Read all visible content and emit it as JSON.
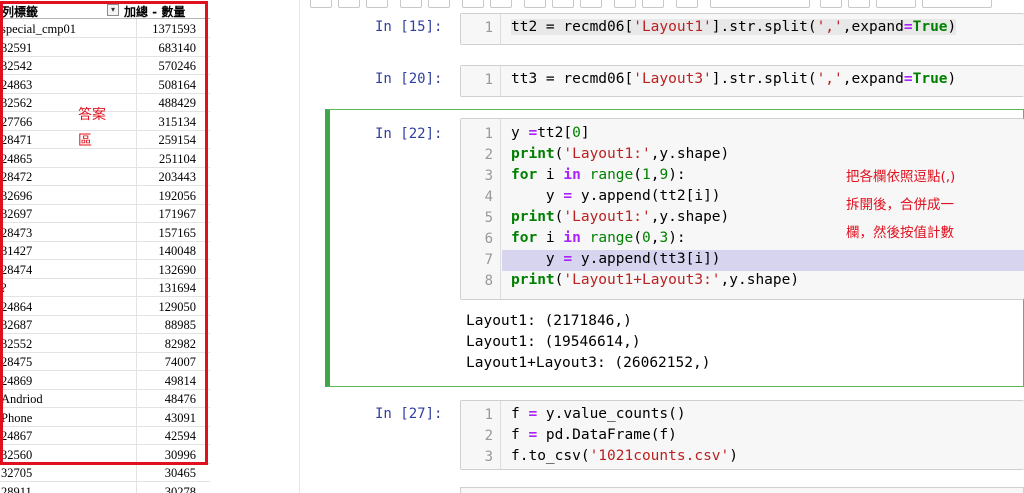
{
  "pivot": {
    "header_label": "列標籤",
    "header_value": "加總 - 數量",
    "filter_icon": "filter-dropdown-icon",
    "rows": [
      {
        "label": "special_cmp01",
        "value": "1371593"
      },
      {
        "label": "32591",
        "value": "683140"
      },
      {
        "label": "32542",
        "value": "570246"
      },
      {
        "label": "24863",
        "value": "508164"
      },
      {
        "label": "32562",
        "value": "488429"
      },
      {
        "label": "27766",
        "value": "315134"
      },
      {
        "label": "28471",
        "value": "259154"
      },
      {
        "label": "24865",
        "value": "251104"
      },
      {
        "label": "28472",
        "value": "203443"
      },
      {
        "label": "32696",
        "value": "192056"
      },
      {
        "label": "32697",
        "value": "171967"
      },
      {
        "label": "28473",
        "value": "157165"
      },
      {
        "label": "31427",
        "value": "140048"
      },
      {
        "label": "28474",
        "value": "132690"
      },
      {
        "label": "?",
        "value": "131694"
      },
      {
        "label": "24864",
        "value": "129050"
      },
      {
        "label": "32687",
        "value": "88985"
      },
      {
        "label": "32552",
        "value": "82982"
      },
      {
        "label": "28475",
        "value": "74007"
      },
      {
        "label": "24869",
        "value": "49814"
      },
      {
        "label": "Andriod",
        "value": "48476"
      },
      {
        "label": "Phone",
        "value": "43091"
      },
      {
        "label": "24867",
        "value": "42594"
      },
      {
        "label": "32560",
        "value": "30996"
      },
      {
        "label": "32705",
        "value": "30465"
      },
      {
        "label": "28911",
        "value": "30278"
      }
    ],
    "annotation_line1": "答案",
    "annotation_line2": "區"
  },
  "notebook": {
    "cells": [
      {
        "prompt": "In [15]:",
        "lines": [
          "1"
        ],
        "code": [
          "tt2 = recmd06['Layout1'].str.split(',',expand=True)"
        ]
      },
      {
        "prompt": "In [20]:",
        "lines": [
          "1"
        ],
        "code": [
          "tt3 = recmd06['Layout3'].str.split(',',expand=True)"
        ]
      },
      {
        "prompt": "In [22]:",
        "lines": [
          "1",
          "2",
          "3",
          "4",
          "5",
          "6",
          "7",
          "8"
        ],
        "code": [
          "y =tt2[0]",
          "print('Layout1:',y.shape)",
          "for i in range(1,9):",
          "    y = y.append(tt2[i])",
          "print('Layout1:',y.shape)",
          "for i in range(0,3):",
          "    y = y.append(tt3[i])",
          "print('Layout1+Layout3:',y.shape)"
        ],
        "output": [
          "Layout1: (2171846,)",
          "Layout1: (19546614,)",
          "Layout1+Layout3: (26062152,)"
        ],
        "annotation": [
          "把各欄依照逗點(,)",
          "拆開後，合併成一",
          "欄，然後按值計數"
        ]
      },
      {
        "prompt": "In [27]:",
        "lines": [
          "1",
          "2",
          "3"
        ],
        "code": [
          "f = y.value_counts()",
          "f = pd.DataFrame(f)",
          "f.to_csv('1021counts.csv')"
        ]
      }
    ]
  },
  "colors": {
    "red_annotation": "#e0101e",
    "selected_cell_border": "#42a649",
    "prompt": "#303f9f",
    "keyword": "#008000",
    "string": "#ba2121",
    "highlight_line": "#d7d4f0"
  }
}
